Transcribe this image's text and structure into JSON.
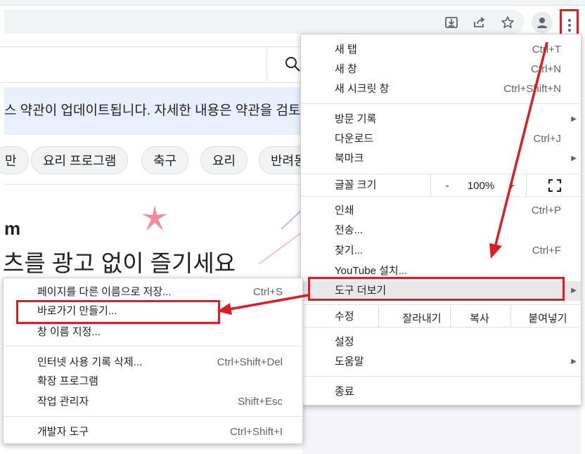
{
  "browser": {
    "toolbar_icons": [
      "download-icon",
      "share-icon",
      "star-icon"
    ],
    "profile_icon": "person-icon",
    "menu_icon": "three-dots-vertical-icon"
  },
  "page": {
    "search_icon": "search-icon",
    "notice_text": "스 약관이 업데이트됩니다. 자세한 내용은 약관을 검토",
    "chips": [
      "만",
      "요리 프로그램",
      "축구",
      "요리",
      "반려동"
    ],
    "promo_title": "m",
    "promo_subtitle": "츠를 광고 없이 즐기세요"
  },
  "main_menu": {
    "new_tab": {
      "label": "새 탭",
      "shortcut": "Ctrl+T"
    },
    "new_window": {
      "label": "새 창",
      "shortcut": "Ctrl+N"
    },
    "new_incognito": {
      "label": "새 시크릿 창",
      "shortcut": "Ctrl+Shift+N"
    },
    "history": {
      "label": "방문 기록"
    },
    "downloads": {
      "label": "다운로드",
      "shortcut": "Ctrl+J"
    },
    "bookmarks": {
      "label": "북마크"
    },
    "zoom": {
      "label": "글꼴 크기",
      "minus": "-",
      "value": "100%",
      "plus": "+"
    },
    "print": {
      "label": "인쇄",
      "shortcut": "Ctrl+P"
    },
    "cast": {
      "label": "전송..."
    },
    "find": {
      "label": "찾기...",
      "shortcut": "Ctrl+F"
    },
    "install": {
      "label": "YouTube 설치..."
    },
    "more_tools": {
      "label": "도구 더보기"
    },
    "edit": {
      "label": "수정",
      "cut": "잘라내기",
      "copy": "복사",
      "paste": "붙여넣기"
    },
    "settings": {
      "label": "설정"
    },
    "help": {
      "label": "도움말"
    },
    "exit": {
      "label": "종료"
    }
  },
  "sub_menu": {
    "save_page": {
      "label": "페이지를 다른 이름으로 저장...",
      "shortcut": "Ctrl+S"
    },
    "create_shortcut": {
      "label": "바로가기 만들기..."
    },
    "name_window": {
      "label": "창 이름 지정..."
    },
    "clear_data": {
      "label": "인터넷 사용 기록 삭제...",
      "shortcut": "Ctrl+Shift+Del"
    },
    "extensions": {
      "label": "확장 프로그램"
    },
    "task_manager": {
      "label": "작업 관리자",
      "shortcut": "Shift+Esc"
    },
    "dev_tools": {
      "label": "개발자 도구",
      "shortcut": "Ctrl+Shift+I"
    }
  },
  "colors": {
    "annotation_red": "#e01b24",
    "highlight_gray": "#e8e8e8",
    "notice_blue": "#e8f0fe",
    "promo_pink": "#f48a9a"
  }
}
